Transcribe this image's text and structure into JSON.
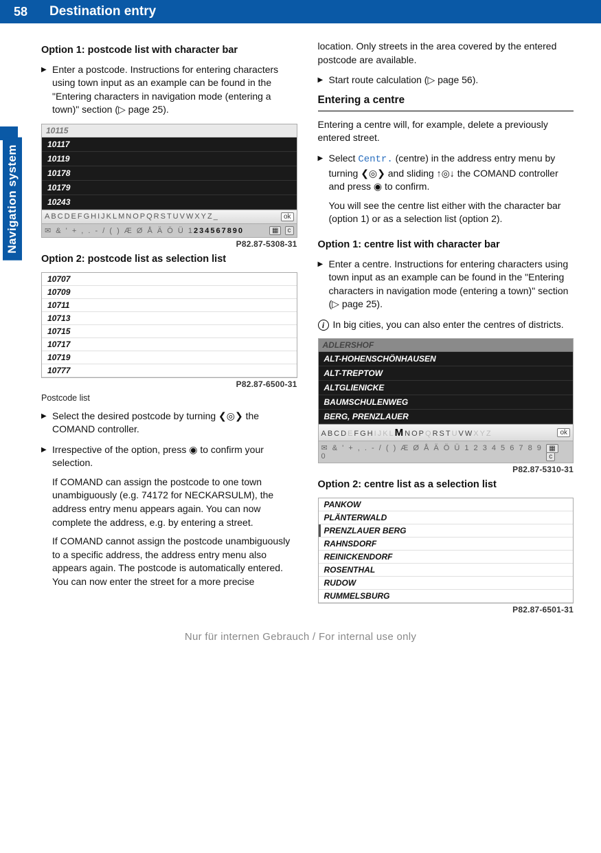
{
  "header": {
    "page_number": "58",
    "title": "Destination entry"
  },
  "side_tab": "Navigation system",
  "left": {
    "option1_heading": "Option 1: postcode list with character bar",
    "step1": "Enter a postcode. Instructions for entering characters using town input as an example can be found in the \"Entering characters in navigation mode (entering a town)\" section (▷ page 25).",
    "fig1": {
      "current": "10115",
      "rows": [
        "10117",
        "10119",
        "10178",
        "10179",
        "10243"
      ],
      "alpha": "ABCDEFGHIJKLMNOPQRSTUVWXYZ_",
      "ok": "ok",
      "sym_prefix": "✉ & ' + , . - / ( ) Æ Ø Å Ä Ö Ü 1",
      "nums": "234567890",
      "flag": "▦",
      "c": "c",
      "ref": "P82.87-5308-31"
    },
    "option2_heading": "Option 2: postcode list as selection list",
    "fig2": {
      "rows": [
        "10707",
        "10709",
        "10711",
        "10713",
        "10715",
        "10717",
        "10719",
        "10777"
      ],
      "ref": "P82.87-6500-31"
    },
    "caption": "Postcode list",
    "step2": "Select the desired postcode by turning ❮◎❯ the COMAND controller.",
    "step3a": "Irrespective of the option, press ◉ to confirm your selection.",
    "step3b": "If COMAND can assign the postcode to one town unambiguously (e.g. 74172 for NECKARSULM), the address entry menu appears again. You can now complete the address, e.g. by entering a street.",
    "step3c": "If COMAND cannot assign the postcode unambiguously to a specific address, the address entry menu also appears again. The postcode is automatically entered. You can now enter the street for a more precise"
  },
  "right": {
    "cont": "location. Only streets in the area covered by the entered postcode are available.",
    "step_route": "Start route calculation (▷ page 56).",
    "heading_centre": "Entering a centre",
    "intro": "Entering a centre will, for example, delete a previously entered street.",
    "step_select_pre": "Select ",
    "step_select_menu": "Centr.",
    "step_select_post": " (centre) in the address entry menu by turning ❮◎❯ and sliding ↑◎↓ the COMAND controller and press ◉ to confirm.",
    "step_select_body": "You will see the centre list either with the character bar (option 1) or as a selection list (option 2).",
    "option1_heading": "Option 1: centre list with character bar",
    "step1": "Enter a centre. Instructions for entering characters using town input as an example can be found in the \"Entering characters in navigation mode (entering a town)\" section (▷ page 25).",
    "note": "In big cities, you can also enter the centres of districts.",
    "fig3": {
      "header": "ADLERSHOF",
      "rows": [
        "ALT-HOHENSCHÖNHAUSEN",
        "ALT-TREPTOW",
        "ALTGLIENICKE",
        "BAUMSCHULENWEG",
        "BERG, PRENZLAUER"
      ],
      "alpha_a": "ABCD",
      "alpha_b": "E",
      "alpha_c": "FGH",
      "alpha_d": "IJKL",
      "alpha_M": "M",
      "alpha_e": "NOP",
      "alpha_f": "Q",
      "alpha_g": "RST",
      "alpha_h": "U",
      "alpha_i": "VW",
      "alpha_j": "XYZ",
      "ok": "ok",
      "sym": "✉ & ' + , . - / ( ) Æ Ø Å Ä Ö Ü 1 2 3 4 5 6 7 8 9 0",
      "flag": "▦",
      "c": "c",
      "ref": "P82.87-5310-31"
    },
    "option2_heading": "Option 2: centre list as a selection list",
    "fig4": {
      "rows": [
        "PANKOW",
        "PLÄNTERWALD",
        "PRENZLAUER BERG",
        "RAHNSDORF",
        "REINICKENDORF",
        "ROSENTHAL",
        "RUDOW",
        "RUMMELSBURG"
      ],
      "selected_index": 2,
      "ref": "P82.87-6501-31"
    }
  },
  "footer": "Nur für internen Gebrauch / For internal use only"
}
